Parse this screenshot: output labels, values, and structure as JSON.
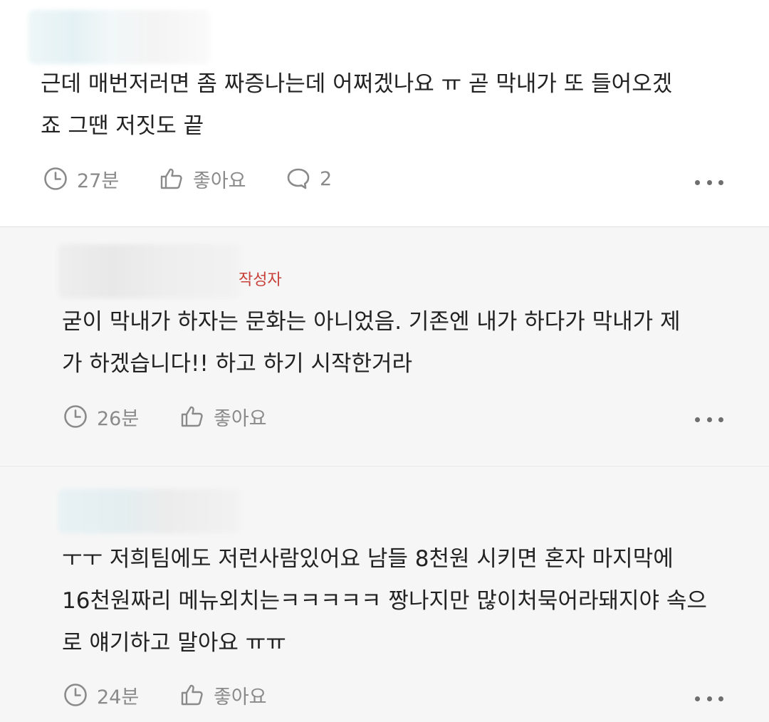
{
  "comments": [
    {
      "text_lines": [
        "근데 매번저러면 좀 짜증나는데 어쩌겠나요 ㅠ 곧 막내가 또 들어오겠",
        "죠 그땐 저짓도 끝"
      ],
      "time": "27분",
      "like_label": "좋아요",
      "reply_count": "2"
    },
    {
      "author_tag": "작성자",
      "text_lines": [
        "굳이 막내가 하자는 문화는 아니었음. 기존엔 내가 하다가 막내가 제",
        "가 하겠습니다!! 하고 하기 시작한거라"
      ],
      "time": "26분",
      "like_label": "좋아요"
    },
    {
      "text_lines": [
        "ㅜㅜ 저희팀에도 저런사람있어요 남들 8천원 시키면 혼자 마지막에",
        "16천원짜리 메뉴외치는ㅋㅋㅋㅋㅋ 짱나지만 많이처묵어라돼지야 속으",
        "로 얘기하고 말아요 ㅠㅠ"
      ],
      "time": "24분",
      "like_label": "좋아요"
    }
  ],
  "icons": {
    "time": "clock-icon",
    "like": "thumbs-up-icon",
    "reply": "speech-bubble-icon",
    "more": "more-dots-icon"
  },
  "colors": {
    "author_tag": "#c8413a",
    "meta_text": "#8a8a8a",
    "reply_background": "#f6f6f6"
  }
}
